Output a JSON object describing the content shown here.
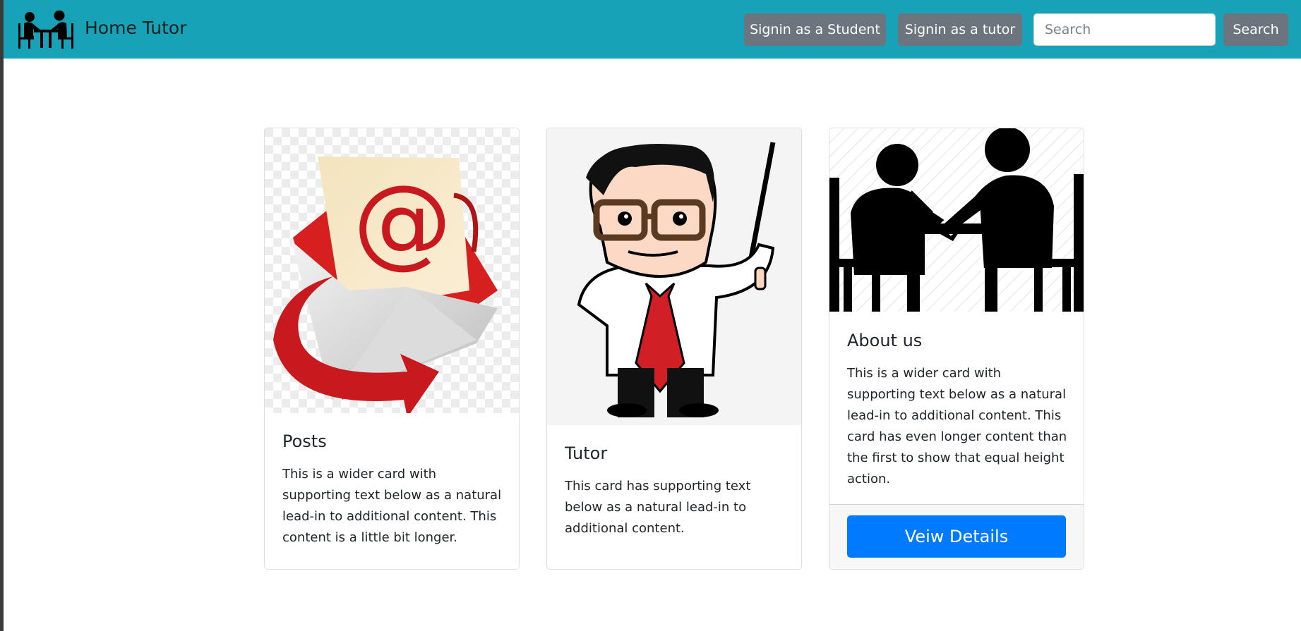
{
  "navbar": {
    "brand": "Home Tutor",
    "brand_icon": "tutoring-people-icon",
    "buttons": {
      "student": "Signin as a Student",
      "tutor": "Signin as a tutor",
      "search": "Search"
    },
    "search_placeholder": "Search",
    "background": "#17a2b8"
  },
  "cards": [
    {
      "image": "email-envelope-icon",
      "title": "Posts",
      "text": "This is a wider card with supporting text below as a natural lead-in to additional content. This content is a little bit longer."
    },
    {
      "image": "tutor-with-pointer-illustration",
      "title": "Tutor",
      "text": "This card has supporting text below as a natural lead-in to additional content."
    },
    {
      "image": "tutoring-session-icon",
      "title": "About us",
      "text": "This is a wider card with supporting text below as a natural lead-in to additional content. This card has even longer content than the first to show that equal height action.",
      "button": "Veiw Details"
    }
  ],
  "colors": {
    "secondary_button": "#6c757d",
    "primary_button": "#007bff"
  }
}
